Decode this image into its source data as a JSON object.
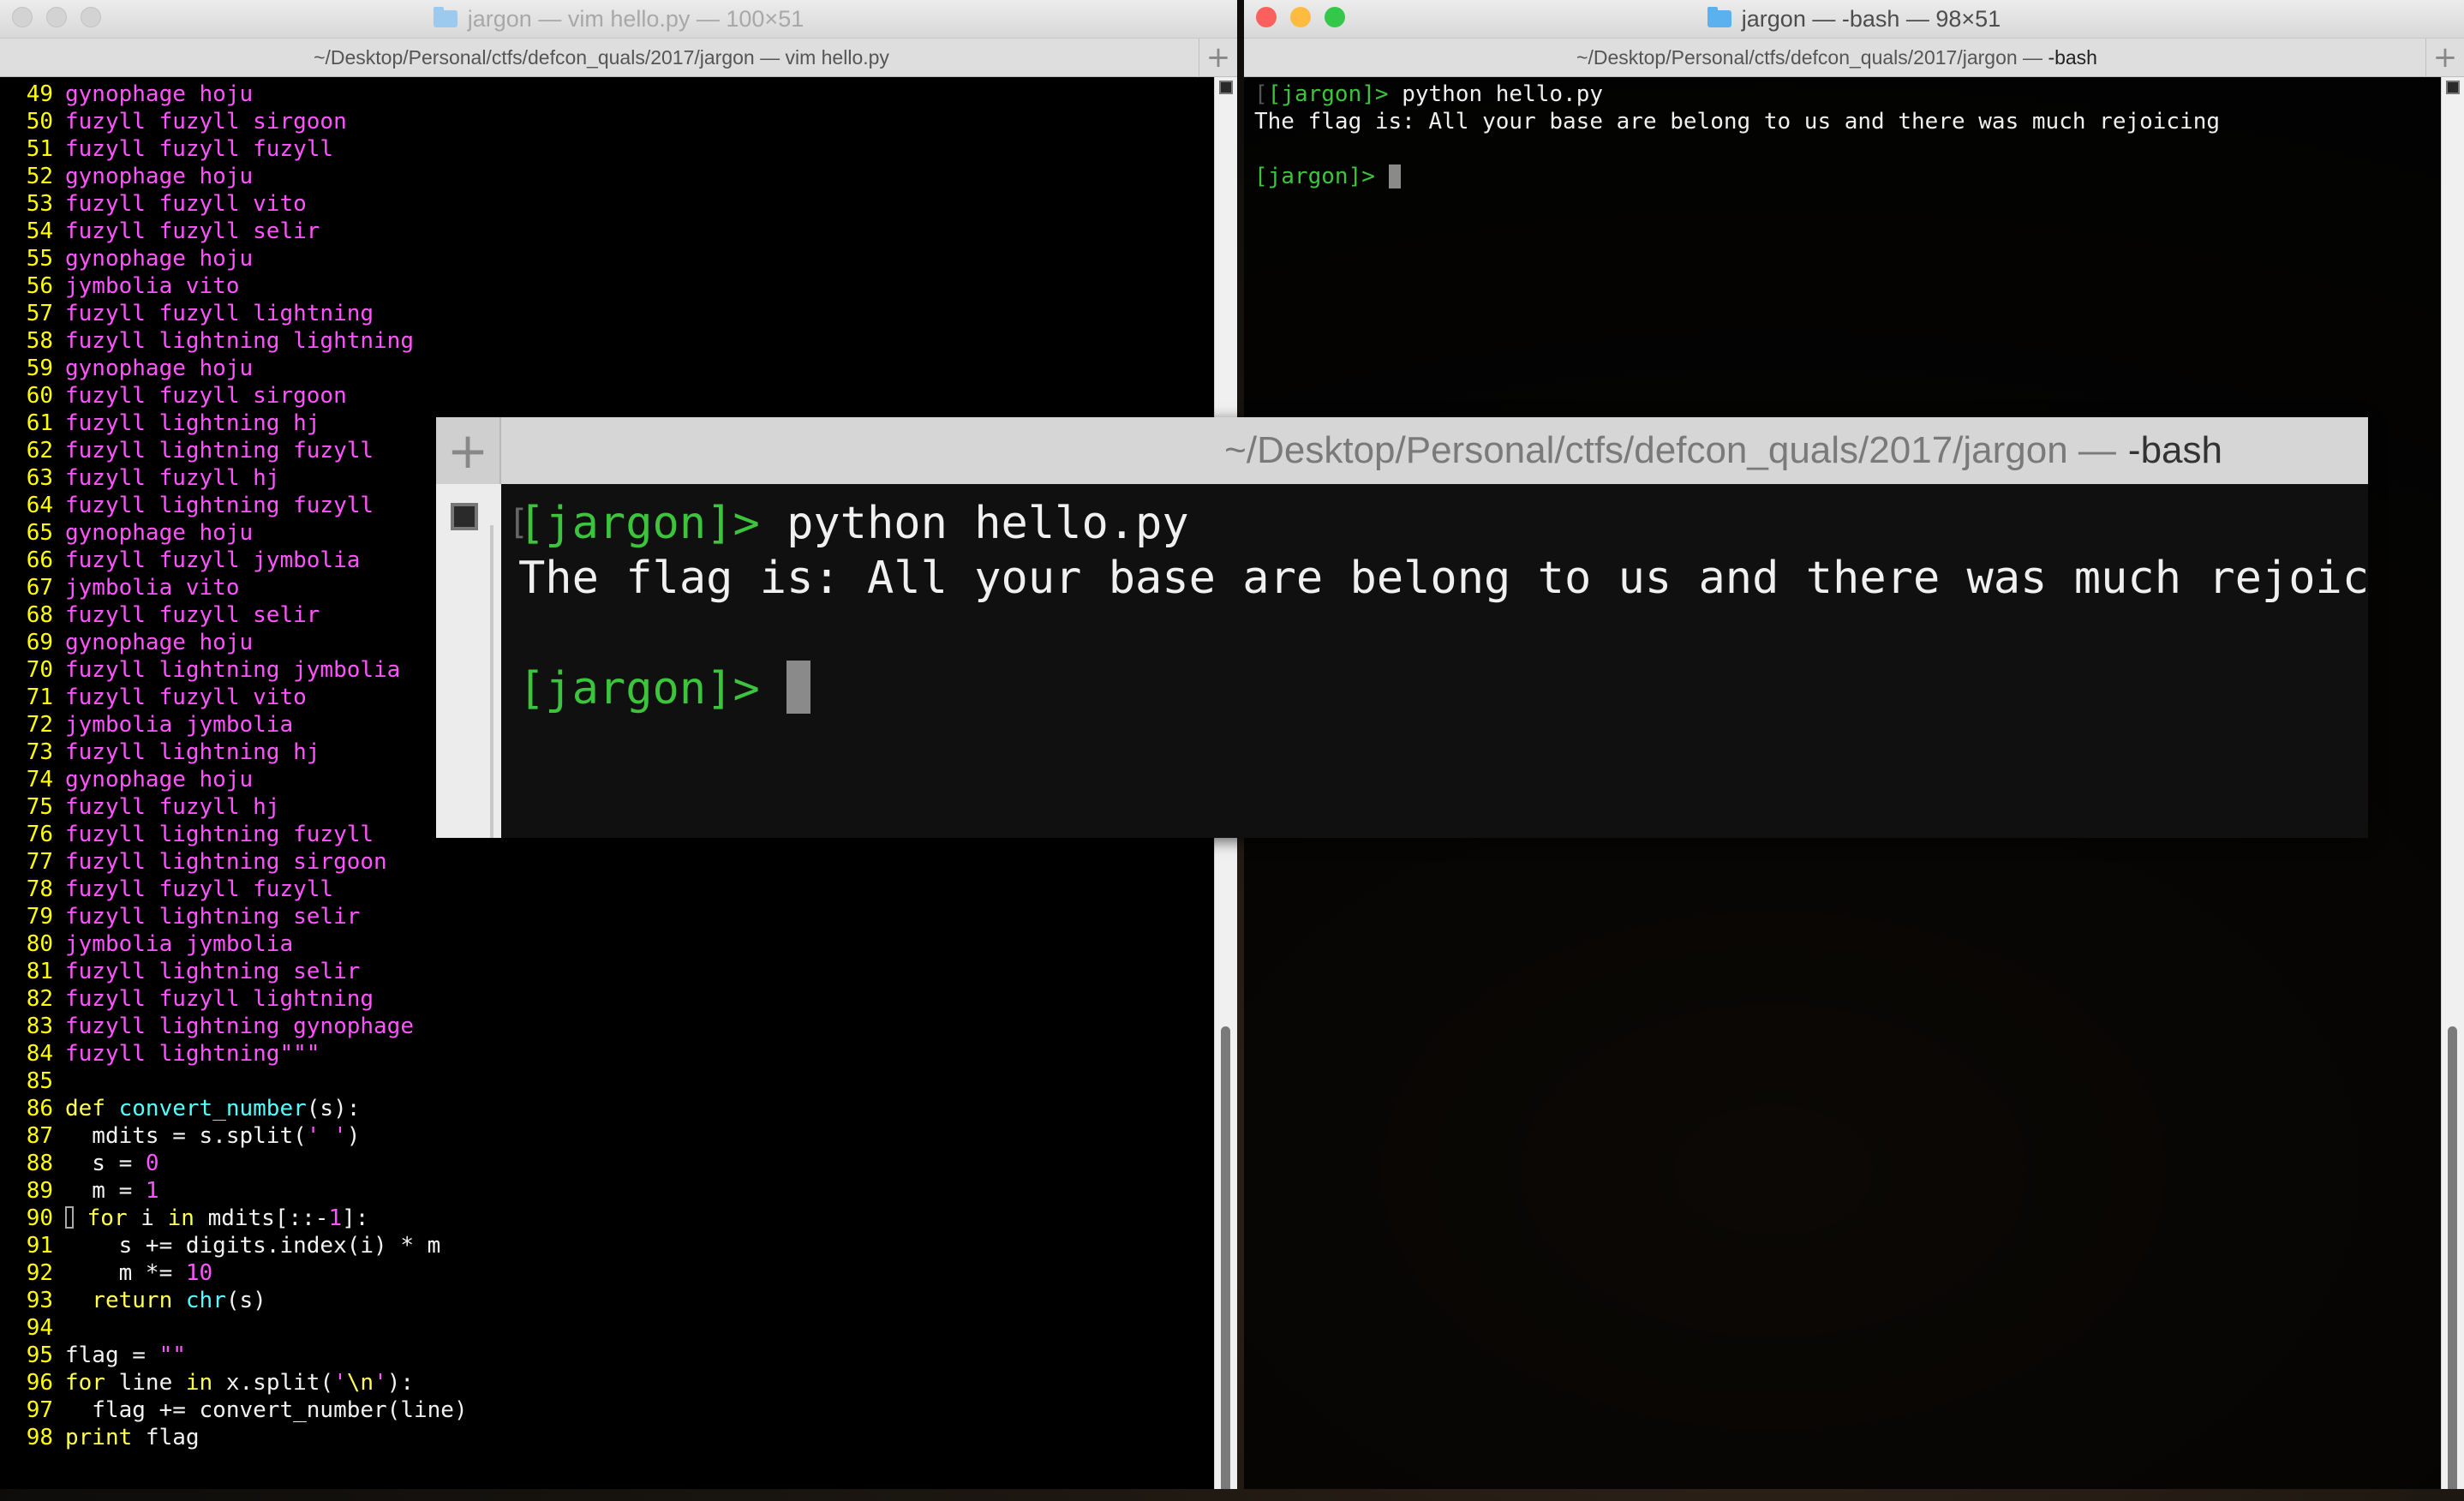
{
  "left_window": {
    "title": "jargon — vim hello.py — 100×51",
    "tab_label": "~/Desktop/Personal/ctfs/defcon_quals/2017/jargon — vim hello.py",
    "folder_icon": "folder-icon"
  },
  "right_window": {
    "title": "jargon — -bash — 98×51",
    "tab_label_path": "~/Desktop/Personal/ctfs/defcon_quals/2017/jargon — ",
    "tab_label_cmd": "-bash",
    "folder_icon": "folder-icon"
  },
  "vim": {
    "lines": [
      {
        "n": "49",
        "segs": [
          {
            "c": "t-mag",
            "t": "gynophage hoju"
          }
        ]
      },
      {
        "n": "50",
        "segs": [
          {
            "c": "t-mag",
            "t": "fuzyll fuzyll sirgoon"
          }
        ]
      },
      {
        "n": "51",
        "segs": [
          {
            "c": "t-mag",
            "t": "fuzyll fuzyll fuzyll"
          }
        ]
      },
      {
        "n": "52",
        "segs": [
          {
            "c": "t-mag",
            "t": "gynophage hoju"
          }
        ]
      },
      {
        "n": "53",
        "segs": [
          {
            "c": "t-mag",
            "t": "fuzyll fuzyll vito"
          }
        ]
      },
      {
        "n": "54",
        "segs": [
          {
            "c": "t-mag",
            "t": "fuzyll fuzyll selir"
          }
        ]
      },
      {
        "n": "55",
        "segs": [
          {
            "c": "t-mag",
            "t": "gynophage hoju"
          }
        ]
      },
      {
        "n": "56",
        "segs": [
          {
            "c": "t-mag",
            "t": "jymbolia vito"
          }
        ]
      },
      {
        "n": "57",
        "segs": [
          {
            "c": "t-mag",
            "t": "fuzyll fuzyll lightning"
          }
        ]
      },
      {
        "n": "58",
        "segs": [
          {
            "c": "t-mag",
            "t": "fuzyll lightning lightning"
          }
        ]
      },
      {
        "n": "59",
        "segs": [
          {
            "c": "t-mag",
            "t": "gynophage hoju"
          }
        ]
      },
      {
        "n": "60",
        "segs": [
          {
            "c": "t-mag",
            "t": "fuzyll fuzyll sirgoon"
          }
        ]
      },
      {
        "n": "61",
        "segs": [
          {
            "c": "t-mag",
            "t": "fuzyll lightning hj"
          }
        ]
      },
      {
        "n": "62",
        "segs": [
          {
            "c": "t-mag",
            "t": "fuzyll lightning fuzyll"
          }
        ]
      },
      {
        "n": "63",
        "segs": [
          {
            "c": "t-mag",
            "t": "fuzyll fuzyll hj"
          }
        ]
      },
      {
        "n": "64",
        "segs": [
          {
            "c": "t-mag",
            "t": "fuzyll lightning fuzyll"
          }
        ]
      },
      {
        "n": "65",
        "segs": [
          {
            "c": "t-mag",
            "t": "gynophage hoju"
          }
        ]
      },
      {
        "n": "66",
        "segs": [
          {
            "c": "t-mag",
            "t": "fuzyll fuzyll jymbolia"
          }
        ]
      },
      {
        "n": "67",
        "segs": [
          {
            "c": "t-mag",
            "t": "jymbolia vito"
          }
        ]
      },
      {
        "n": "68",
        "segs": [
          {
            "c": "t-mag",
            "t": "fuzyll fuzyll selir"
          }
        ]
      },
      {
        "n": "69",
        "segs": [
          {
            "c": "t-mag",
            "t": "gynophage hoju"
          }
        ]
      },
      {
        "n": "70",
        "segs": [
          {
            "c": "t-mag",
            "t": "fuzyll lightning jymbolia"
          }
        ]
      },
      {
        "n": "71",
        "segs": [
          {
            "c": "t-mag",
            "t": "fuzyll fuzyll vito"
          }
        ]
      },
      {
        "n": "72",
        "segs": [
          {
            "c": "t-mag",
            "t": "jymbolia jymbolia"
          }
        ]
      },
      {
        "n": "73",
        "segs": [
          {
            "c": "t-mag",
            "t": "fuzyll lightning hj"
          }
        ]
      },
      {
        "n": "74",
        "segs": [
          {
            "c": "t-mag",
            "t": "gynophage hoju"
          }
        ]
      },
      {
        "n": "75",
        "segs": [
          {
            "c": "t-mag",
            "t": "fuzyll fuzyll hj"
          }
        ]
      },
      {
        "n": "76",
        "segs": [
          {
            "c": "t-mag",
            "t": "fuzyll lightning fuzyll"
          }
        ]
      },
      {
        "n": "77",
        "segs": [
          {
            "c": "t-mag",
            "t": "fuzyll lightning sirgoon"
          }
        ]
      },
      {
        "n": "78",
        "segs": [
          {
            "c": "t-mag",
            "t": "fuzyll fuzyll fuzyll"
          }
        ]
      },
      {
        "n": "79",
        "segs": [
          {
            "c": "t-mag",
            "t": "fuzyll lightning selir"
          }
        ]
      },
      {
        "n": "80",
        "segs": [
          {
            "c": "t-mag",
            "t": "jymbolia jymbolia"
          }
        ]
      },
      {
        "n": "81",
        "segs": [
          {
            "c": "t-mag",
            "t": "fuzyll lightning selir"
          }
        ]
      },
      {
        "n": "82",
        "segs": [
          {
            "c": "t-mag",
            "t": "fuzyll fuzyll lightning"
          }
        ]
      },
      {
        "n": "83",
        "segs": [
          {
            "c": "t-mag",
            "t": "fuzyll lightning gynophage"
          }
        ]
      },
      {
        "n": "84",
        "segs": [
          {
            "c": "t-mag",
            "t": "fuzyll lightning\"\"\""
          }
        ]
      },
      {
        "n": "85",
        "segs": []
      },
      {
        "n": "86",
        "segs": [
          {
            "c": "t-yel",
            "t": "def "
          },
          {
            "c": "t-cyan",
            "t": "convert_number"
          },
          {
            "c": "t-white",
            "t": "(s):"
          }
        ]
      },
      {
        "n": "87",
        "segs": [
          {
            "c": "t-white",
            "t": "  mdits = s.split("
          },
          {
            "c": "t-mag",
            "t": "' '"
          },
          {
            "c": "t-white",
            "t": ")"
          }
        ]
      },
      {
        "n": "88",
        "segs": [
          {
            "c": "t-white",
            "t": "  s = "
          },
          {
            "c": "t-mag",
            "t": "0"
          }
        ]
      },
      {
        "n": "89",
        "segs": [
          {
            "c": "t-white",
            "t": "  m = "
          },
          {
            "c": "t-mag",
            "t": "1"
          }
        ]
      },
      {
        "n": "90",
        "cursor": true,
        "segs": [
          {
            "c": "t-yel",
            "t": "for "
          },
          {
            "c": "t-white",
            "t": "i "
          },
          {
            "c": "t-yel",
            "t": "in "
          },
          {
            "c": "t-white",
            "t": "mdits[::-"
          },
          {
            "c": "t-mag",
            "t": "1"
          },
          {
            "c": "t-white",
            "t": "]:"
          }
        ]
      },
      {
        "n": "91",
        "segs": [
          {
            "c": "t-white",
            "t": "    s += digits.index(i) * m"
          }
        ]
      },
      {
        "n": "92",
        "segs": [
          {
            "c": "t-white",
            "t": "    m *= "
          },
          {
            "c": "t-mag",
            "t": "10"
          }
        ]
      },
      {
        "n": "93",
        "segs": [
          {
            "c": "t-yel",
            "t": "  return "
          },
          {
            "c": "t-cyan",
            "t": "chr"
          },
          {
            "c": "t-white",
            "t": "(s)"
          }
        ]
      },
      {
        "n": "94",
        "segs": []
      },
      {
        "n": "95",
        "segs": [
          {
            "c": "t-white",
            "t": "flag = "
          },
          {
            "c": "t-mag",
            "t": "\"\""
          }
        ]
      },
      {
        "n": "96",
        "segs": [
          {
            "c": "t-yel",
            "t": "for "
          },
          {
            "c": "t-white",
            "t": "line "
          },
          {
            "c": "t-yel",
            "t": "in "
          },
          {
            "c": "t-white",
            "t": "x.split("
          },
          {
            "c": "t-mag",
            "t": "'"
          },
          {
            "c": "t-yel",
            "t": "\\n"
          },
          {
            "c": "t-mag",
            "t": "'"
          },
          {
            "c": "t-white",
            "t": "):"
          }
        ]
      },
      {
        "n": "97",
        "segs": [
          {
            "c": "t-white",
            "t": "  flag += convert_number(line)"
          }
        ]
      },
      {
        "n": "98",
        "segs": [
          {
            "c": "t-yel",
            "t": "print "
          },
          {
            "c": "t-white",
            "t": "flag"
          }
        ]
      }
    ]
  },
  "terminal": {
    "prompt": "[jargon]>",
    "command": " python hello.py",
    "output": "The flag is: All your base are belong to us and there was much rejoicing",
    "prompt2": "[jargon]>",
    "bracket_mark": "["
  },
  "zoom": {
    "tab_path": "~/Desktop/Personal/ctfs/defcon_quals/2017/jargon —",
    "tab_cmd": "-bash",
    "prompt": "[jargon]>",
    "command": " python hello.py",
    "output": "The flag is: All your base are belong to us and there was much rejoicing",
    "prompt2": "[jargon]>",
    "plus": "+",
    "bracket_mark": "["
  },
  "buttons": {
    "new_tab": "+"
  },
  "colors": {
    "line_number": "#ffff00",
    "string_text": "#ff55ff",
    "keyword": "#ffff55",
    "function_name": "#55ffff",
    "prompt": "#3cc43c"
  }
}
